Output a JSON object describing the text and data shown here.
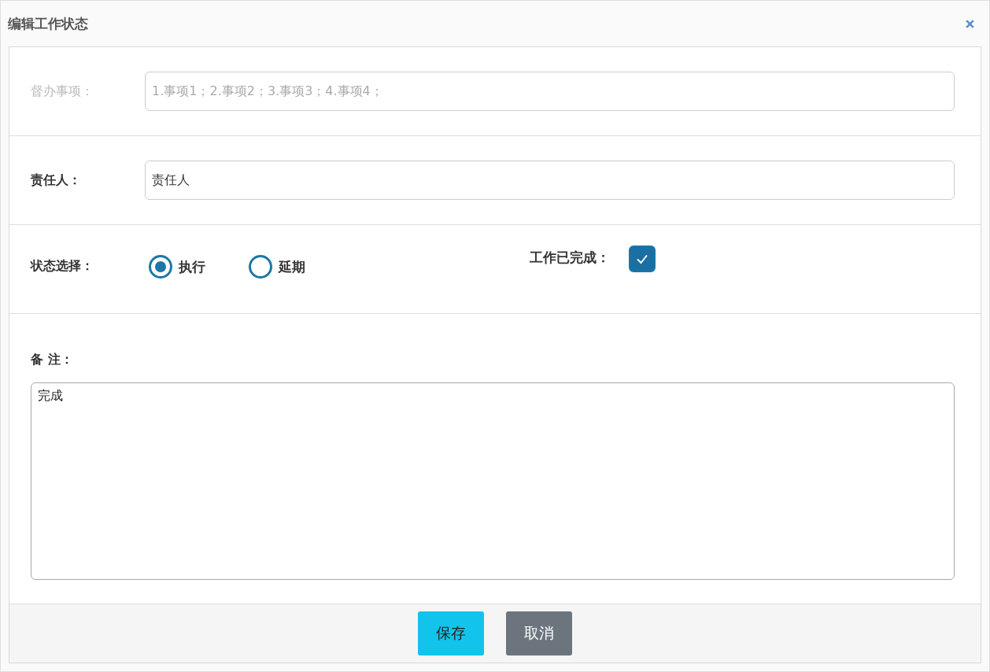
{
  "window": {
    "title": "编辑工作状态"
  },
  "fields": [
    {
      "label": "督办事项：",
      "value": "1.事项1；2.事项2；3.事项3；4.事项4；",
      "disabled": true
    },
    {
      "label": "责任人：",
      "value": "责任人",
      "disabled": false
    }
  ],
  "status": {
    "label": "状态选择：",
    "options": [
      {
        "label": "执行",
        "selected": true
      },
      {
        "label": "延期",
        "selected": false
      }
    ]
  },
  "completed": {
    "label": "工作已完成：",
    "checked": true
  },
  "remarks": {
    "label": "备 注：",
    "value": "完成"
  },
  "buttons": [
    {
      "label": "保存",
      "kind": "primary"
    },
    {
      "label": "取消",
      "kind": "secondary"
    }
  ]
}
